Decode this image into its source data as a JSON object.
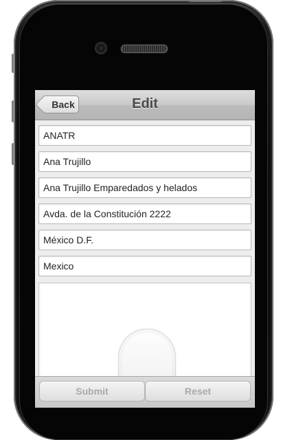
{
  "header": {
    "back_label": "Back",
    "title": "Edit"
  },
  "form": {
    "fields": [
      {
        "value": "ANATR"
      },
      {
        "value": "Ana Trujillo"
      },
      {
        "value": "Ana Trujillo Emparedados y helados"
      },
      {
        "value": "Avda. de la Constitución 2222"
      },
      {
        "value": "México D.F."
      },
      {
        "value": "Mexico"
      }
    ]
  },
  "footer": {
    "submit_label": "Submit",
    "reset_label": "Reset"
  },
  "icons": {
    "back": "chevron-left-icon",
    "camera": "camera-icon",
    "speaker": "speaker-icon"
  },
  "colors": {
    "header_bg": "#c9c9c9",
    "title_text": "#4a4a4a",
    "disabled_text": "#a9a9a9"
  }
}
